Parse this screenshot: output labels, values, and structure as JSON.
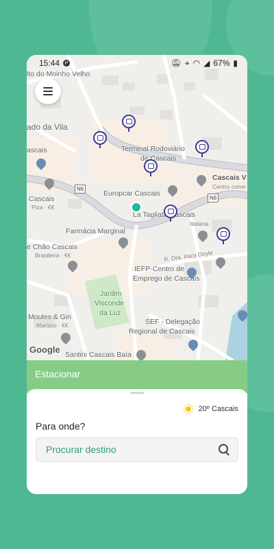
{
  "status_bar": {
    "time": "15:44",
    "battery": "67%"
  },
  "map": {
    "labels": [
      "lto do Moinho Velho",
      "ado da Vila",
      "ascais",
      "Terminal Rodoviário",
      "de Cascais",
      "Cascais V",
      "Centro come",
      "Cascais",
      "Piza · €€",
      "Europcar Cascais",
      "La Tagliata Cascais",
      "Italiana",
      "Farmácia Marginal",
      "e Chão Cascais",
      "Brasileira · €€",
      "R. Dra. Iracy Doyle",
      "IEFP-Centro de",
      "Emprego de Cascais",
      "Jardim",
      "Visconde",
      "da Luz",
      "Moules & Gin",
      "Marisco · €€",
      "SEF - Delegação",
      "Regional de Cascais",
      "Santini Cascais Baía"
    ],
    "road_signs": [
      "N6",
      "N6"
    ],
    "attribution": "Google"
  },
  "park_tab": {
    "label": "Estacionar"
  },
  "sheet": {
    "weather": {
      "text": "20º Cascais",
      "icon": "sun-icon"
    },
    "question": "Para onde?",
    "search": {
      "placeholder": "Procurar destino",
      "value": ""
    }
  }
}
